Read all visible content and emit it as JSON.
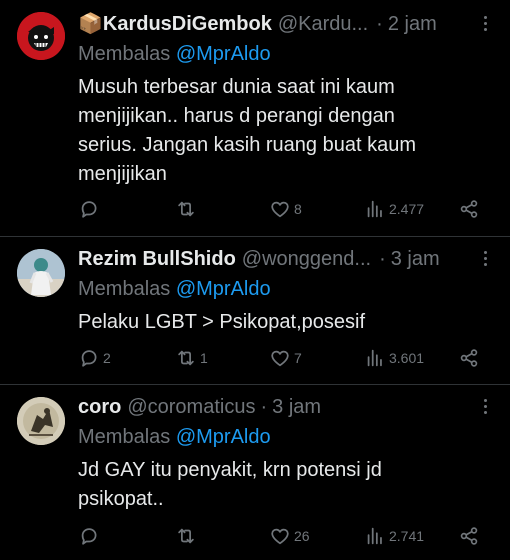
{
  "reply_prefix": "Membalas",
  "colors": {
    "background": "#000000",
    "text": "#e7e9ea",
    "muted": "#71767b",
    "link": "#1d9bf0",
    "divider": "#2f3336"
  },
  "icons": {
    "reply": "speech-bubble-icon",
    "retweet": "retweet-icon",
    "like": "heart-icon",
    "views": "bar-chart-icon",
    "share": "share-icon",
    "more": "more-vertical-icon"
  },
  "tweets": [
    {
      "display_name": "📦KardusDiGembok",
      "handle": "@Kardu...",
      "time": "2 jam",
      "reply_to": "@MprAldo",
      "text": "Musuh terbesar dunia saat ini kaum\nmenjijikan.. harus d perangi dengan\nserius. Jangan kasih ruang buat kaum\nmenjijikan",
      "replies": "",
      "retweets": "",
      "likes": "8",
      "views": "2.477"
    },
    {
      "display_name": "Rezim BullShido",
      "handle": "@wonggend...",
      "time": "3 jam",
      "reply_to": "@MprAldo",
      "text": "Pelaku LGBT > Psikopat,posesif",
      "replies": "2",
      "retweets": "1",
      "likes": "7",
      "views": "3.601"
    },
    {
      "display_name": "coro",
      "handle": "@coromaticus",
      "time": "3 jam",
      "reply_to": "@MprAldo",
      "text": "Jd GAY itu penyakit, krn potensi jd\npsikopat..",
      "replies": "",
      "retweets": "",
      "likes": "26",
      "views": "2.741"
    }
  ]
}
